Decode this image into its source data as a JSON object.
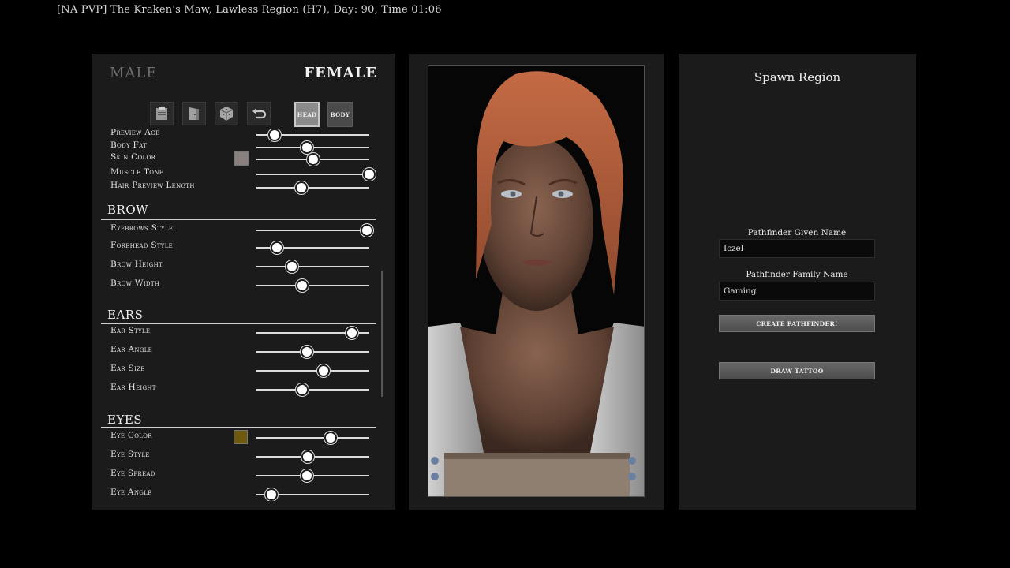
{
  "window_title": "[NA PVP] The Kraken's Maw, Lawless Region (H7), Day: 90, Time 01:06",
  "gender": {
    "male": "MALE",
    "female": "FEMALE",
    "selected": "female"
  },
  "toolbar": {
    "icons": [
      "clipboard-icon",
      "door-icon",
      "dice-icon",
      "undo-icon"
    ],
    "head_tab": "HEAD",
    "body_tab": "BODY",
    "active_tab": "head"
  },
  "body_sliders": [
    {
      "label": "Preview Age",
      "value": 0.16
    },
    {
      "label": "Body Fat",
      "value": 0.45
    },
    {
      "label": "Skin Color",
      "value": 0.5,
      "swatch": "#8a8080"
    },
    {
      "label": "Muscle Tone",
      "value": 1.0
    },
    {
      "label": "Hair Preview Length",
      "value": 0.4
    }
  ],
  "sections": [
    {
      "title": "BROW",
      "sliders": [
        {
          "label": "Eyebrows Style",
          "value": 0.98
        },
        {
          "label": "Forehead Style",
          "value": 0.19
        },
        {
          "label": "Brow Height",
          "value": 0.32
        },
        {
          "label": "Brow Width",
          "value": 0.41
        }
      ]
    },
    {
      "title": "EARS",
      "sliders": [
        {
          "label": "Ear Style",
          "value": 0.85
        },
        {
          "label": "Ear Angle",
          "value": 0.45
        },
        {
          "label": "Ear Size",
          "value": 0.6
        },
        {
          "label": "Ear Height",
          "value": 0.41
        }
      ]
    },
    {
      "title": "EYES",
      "sliders": [
        {
          "label": "Eye Color",
          "value": 0.66,
          "swatch": "#6e5a0e"
        },
        {
          "label": "Eye Style",
          "value": 0.46
        },
        {
          "label": "Eye Spread",
          "value": 0.45
        },
        {
          "label": "Eye Angle",
          "value": 0.14
        }
      ]
    }
  ],
  "right": {
    "title": "Spawn Region",
    "given_label": "Pathfinder Given Name",
    "given_value": "Iczel",
    "family_label": "Pathfinder Family Name",
    "family_value": "Gaming",
    "create_button": "CREATE PATHFINDER!",
    "tattoo_button": "DRAW TATTOO"
  },
  "colors": {
    "panel": "#1b1b1b",
    "background": "#000000",
    "hair": "#b8613e"
  }
}
